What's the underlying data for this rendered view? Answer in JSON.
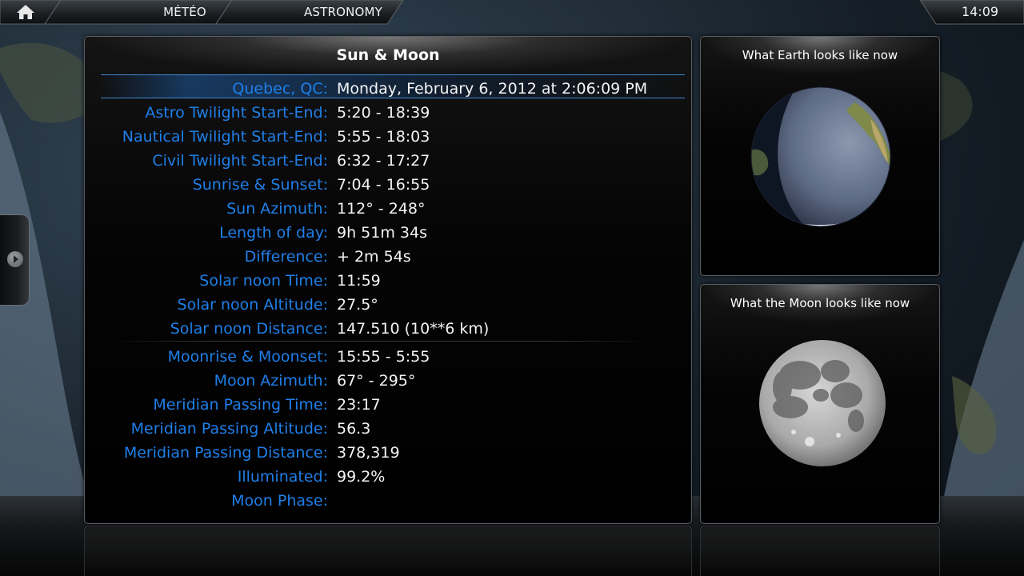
{
  "topbar": {
    "home_icon": "home-icon",
    "breadcrumb": [
      "MÉTÉO",
      "ASTRONOMY"
    ],
    "clock": "14:09"
  },
  "colors": {
    "label": "#1f7fe8",
    "value": "#f4f4f4",
    "highlight": "#1e5aa0"
  },
  "main": {
    "title": "Sun & Moon",
    "location": {
      "label": "Quebec, QC:",
      "value": "Monday, February 6, 2012 at 2:06:09 PM"
    },
    "sun_rows": [
      {
        "label": "Astro Twilight Start-End:",
        "value": "5:20 - 18:39"
      },
      {
        "label": "Nautical Twilight Start-End:",
        "value": "5:55 - 18:03"
      },
      {
        "label": "Civil Twilight Start-End:",
        "value": "6:32 - 17:27"
      },
      {
        "label": "Sunrise & Sunset:",
        "value": "7:04 - 16:55"
      },
      {
        "label": "Sun Azimuth:",
        "value": "112° - 248°"
      },
      {
        "label": "Length of day:",
        "value": "9h 51m 34s"
      },
      {
        "label": "Difference:",
        "value": "+ 2m 54s"
      },
      {
        "label": "Solar noon Time:",
        "value": "11:59"
      },
      {
        "label": "Solar noon Altitude:",
        "value": "27.5°"
      },
      {
        "label": "Solar noon Distance:",
        "value": "147.510 (10**6 km)"
      }
    ],
    "moon_rows": [
      {
        "label": "Moonrise & Moonset:",
        "value": "15:55 - 5:55"
      },
      {
        "label": "Moon Azimuth:",
        "value": "67° - 295°"
      },
      {
        "label": "Meridian Passing Time:",
        "value": "23:17"
      },
      {
        "label": "Meridian Passing Altitude:",
        "value": "56.3"
      },
      {
        "label": "Meridian Passing Distance:",
        "value": "378,319"
      },
      {
        "label": "Illuminated:",
        "value": "99.2%"
      },
      {
        "label": "Moon Phase:",
        "value": ""
      }
    ]
  },
  "earth_panel": {
    "title": "What Earth looks like now"
  },
  "moon_panel": {
    "title": "What the Moon looks like now"
  }
}
